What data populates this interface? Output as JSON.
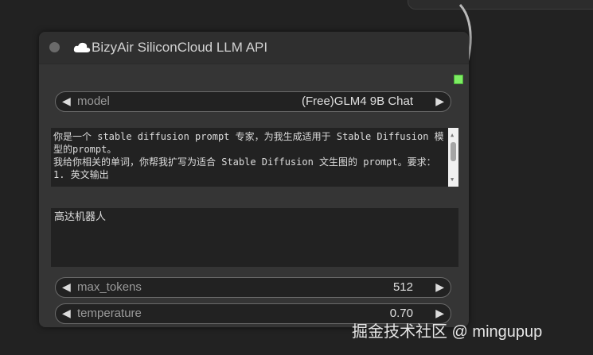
{
  "top_node": {
    "text": "—·‒·—·—·—·"
  },
  "node": {
    "title": "BizyAir SiliconCloud LLM API",
    "model": {
      "label": "model",
      "value": "(Free)GLM4 9B Chat"
    },
    "system_prompt": "你是一个 stable diffusion prompt 专家，为我生成适用于 Stable Diffusion 模型的prompt。\n我给你相关的单词，你帮我扩写为适合 Stable Diffusion 文生图的 prompt。要求：\n1. 英文输出",
    "user_prompt": "高达机器人",
    "max_tokens": {
      "label": "max_tokens",
      "value": "512"
    },
    "temperature": {
      "label": "temperature",
      "value": "0.70"
    }
  },
  "icons": {
    "left_arrow": "◀",
    "right_arrow": "▶",
    "scroll_up": "▲",
    "scroll_down": "▼"
  },
  "colors": {
    "background": "#222222",
    "node": "#353535",
    "output_slot": "#7ded63"
  },
  "watermark": "掘金技术社区 @ mingupup"
}
